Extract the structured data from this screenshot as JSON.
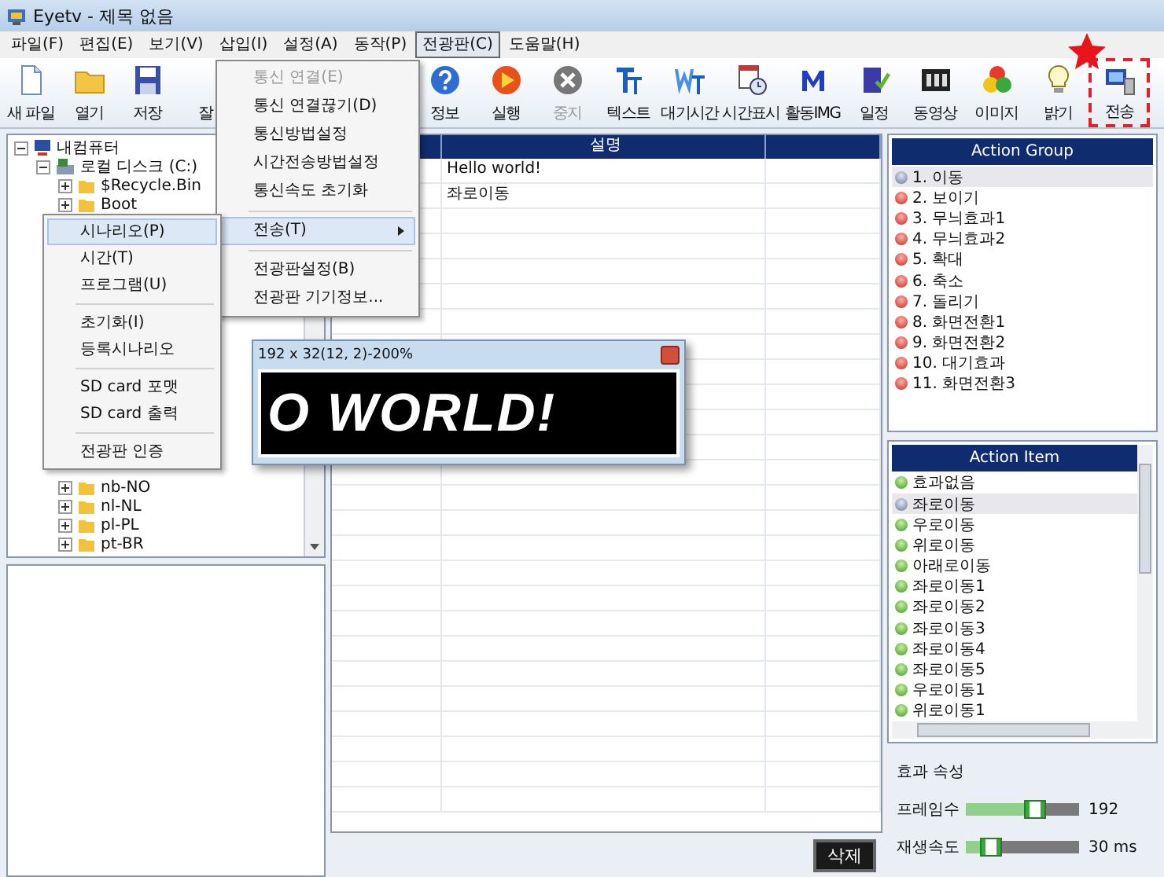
{
  "window": {
    "title": "Eyetv - 제목 없음"
  },
  "menu_bar": [
    {
      "label": "파일(F)",
      "selected": false
    },
    {
      "label": "편집(E)",
      "selected": false
    },
    {
      "label": "보기(V)",
      "selected": false
    },
    {
      "label": "삽입(I)",
      "selected": false
    },
    {
      "label": "설정(A)",
      "selected": false
    },
    {
      "label": "동작(P)",
      "selected": false
    },
    {
      "label": "전광판(C)",
      "selected": true
    },
    {
      "label": "도움말(H)",
      "selected": false
    }
  ],
  "toolbar": [
    {
      "label": "새 파일",
      "disabled": false,
      "highlighted": false
    },
    {
      "label": "열기",
      "disabled": false,
      "highlighted": false
    },
    {
      "label": "저장",
      "disabled": false,
      "highlighted": false
    },
    {
      "label": "잘",
      "disabled": false,
      "highlighted": false
    },
    {
      "label": "정보",
      "disabled": false,
      "highlighted": false
    },
    {
      "label": "실행",
      "disabled": false,
      "highlighted": false
    },
    {
      "label": "중지",
      "disabled": true,
      "highlighted": false
    },
    {
      "label": "텍스트",
      "disabled": false,
      "highlighted": false
    },
    {
      "label": "대기시간",
      "disabled": false,
      "highlighted": false
    },
    {
      "label": "시간표시",
      "disabled": false,
      "highlighted": false
    },
    {
      "label": "활동IMG",
      "disabled": false,
      "highlighted": false
    },
    {
      "label": "일정",
      "disabled": false,
      "highlighted": false
    },
    {
      "label": "동영상",
      "disabled": false,
      "highlighted": false
    },
    {
      "label": "이미지",
      "disabled": false,
      "highlighted": false
    },
    {
      "label": "밝기",
      "disabled": false,
      "highlighted": false
    },
    {
      "label": "전송",
      "disabled": false,
      "highlighted": true
    }
  ],
  "panel_menu": {
    "items": [
      {
        "kind": "item",
        "label": "통신 연결(E)",
        "disabled": true,
        "selected": false
      },
      {
        "kind": "item",
        "label": "통신 연결끊기(D)",
        "disabled": false,
        "selected": false
      },
      {
        "kind": "item",
        "label": "통신방법설정",
        "disabled": false,
        "selected": false
      },
      {
        "kind": "item",
        "label": "시간전송방법설정",
        "disabled": false,
        "selected": false
      },
      {
        "kind": "item",
        "label": "통신속도 초기화",
        "disabled": false,
        "selected": false
      },
      {
        "kind": "separator"
      },
      {
        "kind": "submenu",
        "label": "전송(T)",
        "disabled": false,
        "selected": true
      },
      {
        "kind": "separator"
      },
      {
        "kind": "item",
        "label": "전광판설정(B)",
        "disabled": false,
        "selected": false
      },
      {
        "kind": "item",
        "label": "전광판 기기정보...",
        "disabled": false,
        "selected": false
      }
    ]
  },
  "transfer_submenu": {
    "items": [
      {
        "kind": "item",
        "label": "시나리오(P)",
        "selected": true
      },
      {
        "kind": "item",
        "label": "시간(T)",
        "selected": false
      },
      {
        "kind": "item",
        "label": "프로그램(U)",
        "selected": false
      },
      {
        "kind": "separator"
      },
      {
        "kind": "item",
        "label": "초기화(I)",
        "selected": false
      },
      {
        "kind": "item",
        "label": "등록시나리오",
        "selected": false
      },
      {
        "kind": "separator"
      },
      {
        "kind": "item",
        "label": "SD card 포맷",
        "selected": false
      },
      {
        "kind": "item",
        "label": "SD card 출력",
        "selected": false
      },
      {
        "kind": "separator"
      },
      {
        "kind": "item",
        "label": "전광판 인증",
        "selected": false
      }
    ]
  },
  "file_tree": {
    "label": "내컴퓨터",
    "expanded": true,
    "children": [
      {
        "label": "로컬 디스크 (C:)",
        "expanded": true,
        "children": [
          {
            "label": "$Recycle.Bin",
            "expanded": false
          },
          {
            "label": "Boot",
            "expanded": false
          },
          {
            "label": "nb-NO",
            "expanded": false
          },
          {
            "label": "nl-NL",
            "expanded": false
          },
          {
            "label": "pl-PL",
            "expanded": false
          },
          {
            "label": "pt-BR",
            "expanded": false
          }
        ]
      }
    ]
  },
  "table": {
    "heading": "설명",
    "rows": [
      {
        "description": "Hello world!"
      },
      {
        "description": "좌로이동"
      }
    ]
  },
  "delete_button": "삭제",
  "preview": {
    "title": "192 x 32(12, 2)-200%",
    "display_text": "O WORLD!"
  },
  "action_group": {
    "title": "Action Group",
    "items": [
      {
        "label": "1. 이동",
        "selected": true
      },
      {
        "label": "2. 보이기",
        "selected": false
      },
      {
        "label": "3. 무늬효과1",
        "selected": false
      },
      {
        "label": "4. 무늬효과2",
        "selected": false
      },
      {
        "label": "5. 확대",
        "selected": false
      },
      {
        "label": "6. 축소",
        "selected": false
      },
      {
        "label": "7. 돌리기",
        "selected": false
      },
      {
        "label": "8. 화면전환1",
        "selected": false
      },
      {
        "label": "9. 화면전환2",
        "selected": false
      },
      {
        "label": "10. 대기효과",
        "selected": false
      },
      {
        "label": "11. 화면전환3",
        "selected": false
      }
    ]
  },
  "action_item": {
    "title": "Action Item",
    "items": [
      {
        "label": "효과없음",
        "selected": false
      },
      {
        "label": "좌로이동",
        "selected": true
      },
      {
        "label": "우로이동",
        "selected": false
      },
      {
        "label": "위로이동",
        "selected": false
      },
      {
        "label": "아래로이동",
        "selected": false
      },
      {
        "label": "좌로이동1",
        "selected": false
      },
      {
        "label": "좌로이동2",
        "selected": false
      },
      {
        "label": "좌로이동3",
        "selected": false
      },
      {
        "label": "좌로이동4",
        "selected": false
      },
      {
        "label": "좌로이동5",
        "selected": false
      },
      {
        "label": "우로이동1",
        "selected": false
      },
      {
        "label": "위로이동1",
        "selected": false
      }
    ]
  },
  "effect_properties": {
    "title": "효과 속성",
    "sliders": [
      {
        "label": "프레임수",
        "level": 0.52,
        "reading": "192"
      },
      {
        "label": "재생속도",
        "level": 0.12,
        "reading": "30 ms"
      }
    ]
  }
}
